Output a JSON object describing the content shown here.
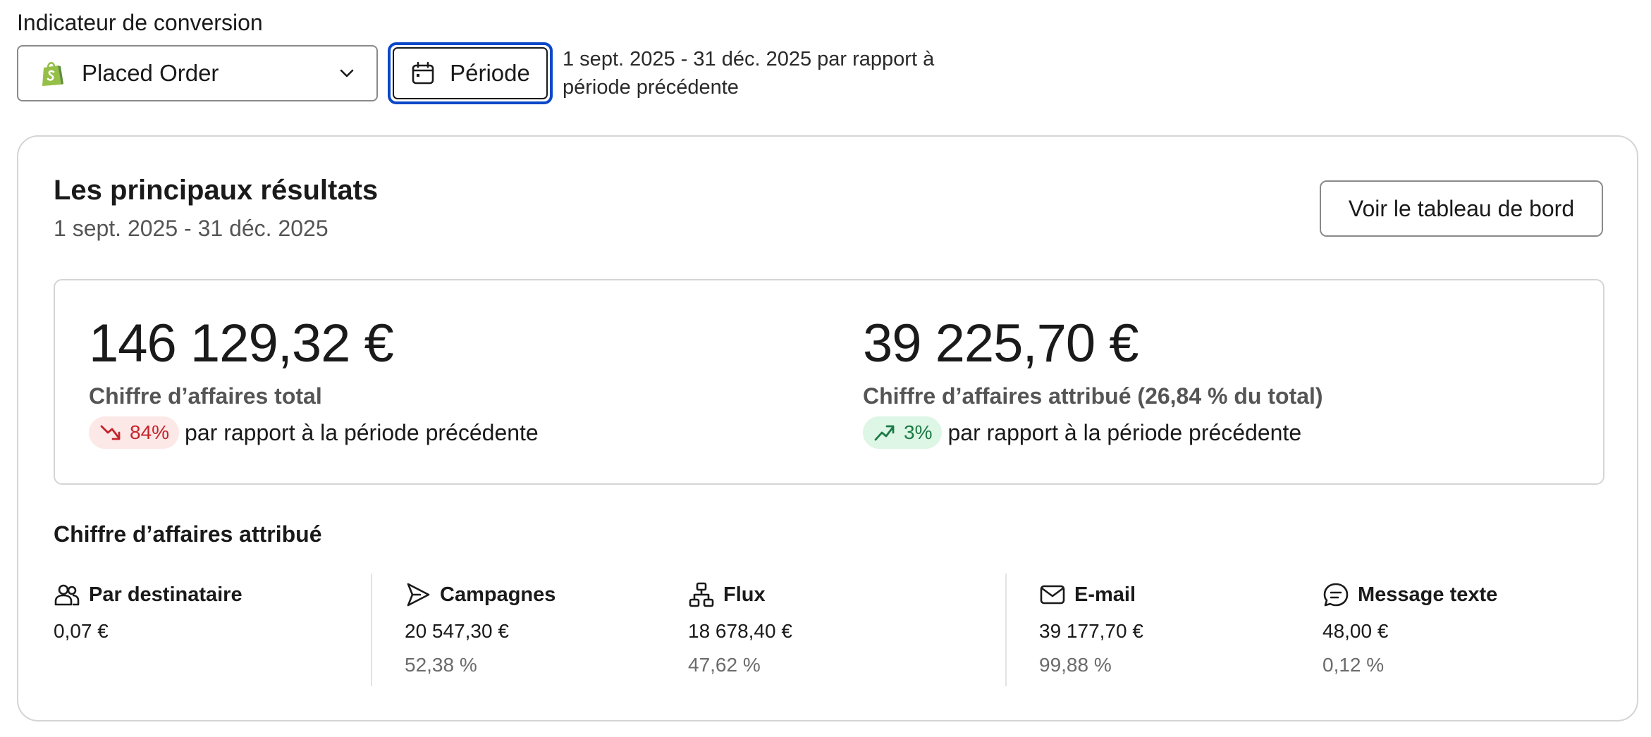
{
  "header": {
    "label": "Indicateur de conversion",
    "metric_select": {
      "value": "Placed Order",
      "icon": "shopify-icon"
    },
    "period_button": {
      "label": "Période",
      "icon": "calendar-icon"
    },
    "period_text": "1 sept. 2025 - 31 déc. 2025 par rapport à période précédente"
  },
  "card": {
    "title": "Les principaux résultats",
    "subtitle": "1 sept. 2025 - 31 déc. 2025",
    "dashboard_button": "Voir le tableau de bord",
    "kpis": [
      {
        "value": "146 129,32 €",
        "label": "Chiffre d’affaires total",
        "change": "84%",
        "direction": "down",
        "comparison": "par rapport à la période précédente"
      },
      {
        "value": "39 225,70 €",
        "label": "Chiffre d’affaires attribué (26,84 % du total)",
        "change": "3%",
        "direction": "up",
        "comparison": "par rapport à la période précédente"
      }
    ],
    "attributed_title": "Chiffre d’affaires attribué",
    "columns": [
      {
        "title": "Par destinataire",
        "icon": "users-icon",
        "value": "0,07 €"
      },
      {
        "title": "Campagnes",
        "icon": "send-icon",
        "value": "20 547,30 €",
        "percent": "52,38 %"
      },
      {
        "title": "Flux",
        "icon": "flow-icon",
        "value": "18 678,40 €",
        "percent": "47,62 %"
      },
      {
        "title": "E-mail",
        "icon": "mail-icon",
        "value": "39 177,70 €",
        "percent": "99,88 %"
      },
      {
        "title": "Message texte",
        "icon": "message-icon",
        "value": "48,00 €",
        "percent": "0,12 %"
      }
    ]
  },
  "colors": {
    "accent": "#0b48c8",
    "down": "#c4242b",
    "down_bg": "#fde8e8",
    "up": "#1c7a44",
    "up_bg": "#ddf6e6",
    "shopify": "#5e8e3e"
  }
}
